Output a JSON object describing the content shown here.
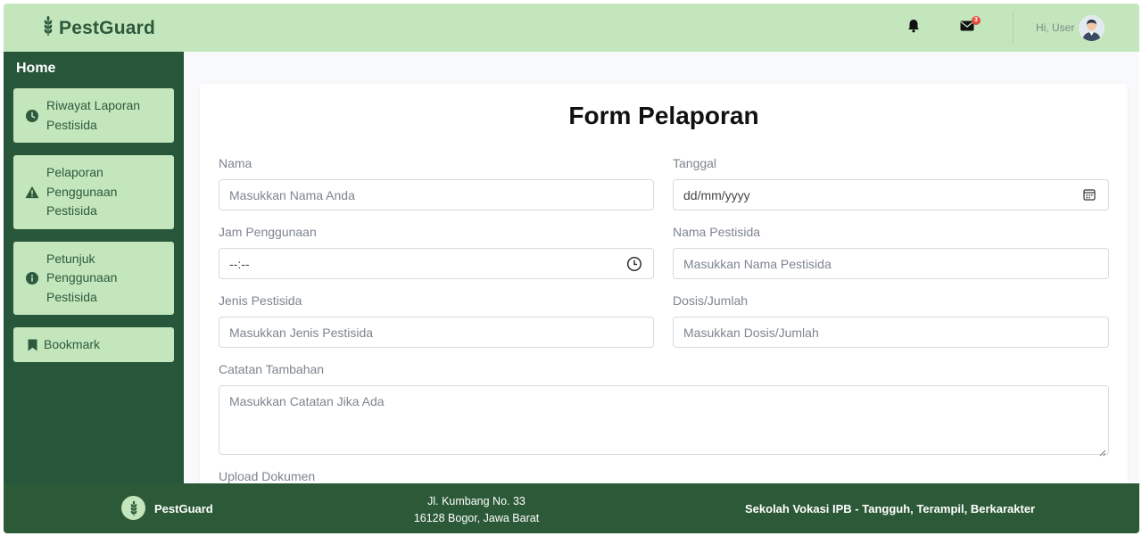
{
  "header": {
    "brand": "PestGuard",
    "notification_badge": "3",
    "greeting": "Hi, User"
  },
  "sidebar": {
    "home_label": "Home",
    "items": [
      {
        "label_lines": [
          "Riwayat Laporan",
          "Pestisida"
        ],
        "icon": "clock-icon"
      },
      {
        "label_lines": [
          "Pelaporan",
          "Penggunaan",
          "Pestisida"
        ],
        "icon": "warning-icon"
      },
      {
        "label_lines": [
          "Petunjuk",
          "Penggunaan",
          "Pestisida"
        ],
        "icon": "info-icon"
      },
      {
        "label_lines": [
          "Bookmark"
        ],
        "icon": "bookmark-icon"
      }
    ]
  },
  "form": {
    "title": "Form Pelaporan",
    "nama": {
      "label": "Nama",
      "placeholder": "Masukkan Nama Anda"
    },
    "tanggal": {
      "label": "Tanggal",
      "placeholder": "dd/mm/yyyy"
    },
    "jam": {
      "label": "Jam Penggunaan",
      "placeholder": "--:--"
    },
    "nama_pestisida": {
      "label": "Nama Pestisida",
      "placeholder": "Masukkan Nama Pestisida"
    },
    "jenis": {
      "label": "Jenis Pestisida",
      "placeholder": "Masukkan Jenis Pestisida"
    },
    "dosis": {
      "label": "Dosis/Jumlah",
      "placeholder": "Masukkan Dosis/Jumlah"
    },
    "catatan": {
      "label": "Catatan Tambahan",
      "placeholder": "Masukkan Catatan Jika Ada"
    },
    "upload": {
      "label": "Upload Dokumen"
    }
  },
  "footer": {
    "brand": "PestGuard",
    "address_line1": "Jl. Kumbang No. 33",
    "address_line2": "16128 Bogor, Jawa Barat",
    "slogan": "Sekolah Vokasi IPB - Tangguh, Terampil, Berkarakter"
  },
  "colors": {
    "header_bg": "#c3e6bc",
    "sidebar_bg": "#28563b",
    "footer_bg": "#2c5a38",
    "brand_text": "#2d5a3d",
    "badge": "#e74c3c"
  }
}
